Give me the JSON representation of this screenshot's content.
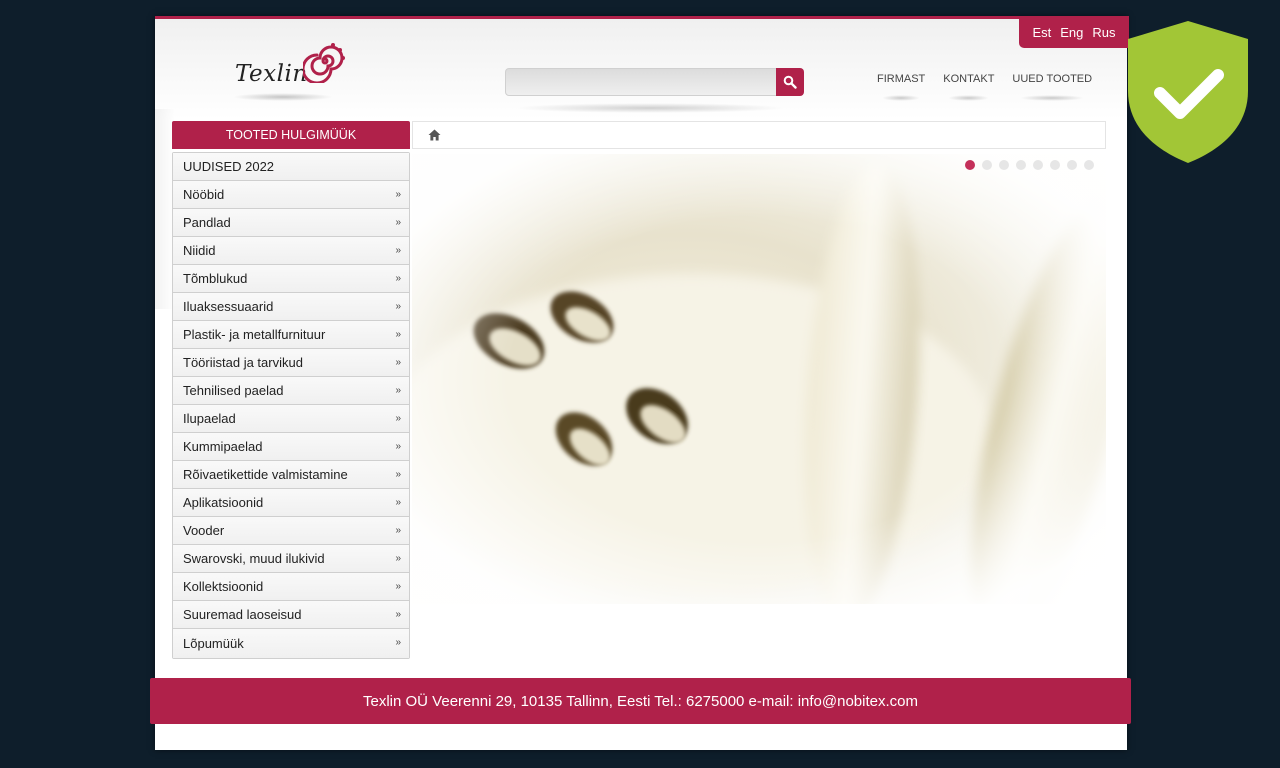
{
  "brand": {
    "logo_text": "Texlin",
    "accent": "#b0214a"
  },
  "lang": [
    "Est",
    "Eng",
    "Rus"
  ],
  "search": {
    "placeholder": ""
  },
  "topnav": [
    "FIRMAST",
    "KONTAKT",
    "UUED TOOTED"
  ],
  "sidebar": {
    "title": "TOOTED HULGIMÜÜK",
    "items": [
      {
        "label": "UUDISED 2022",
        "has_arrow": false
      },
      {
        "label": "Nööbid",
        "has_arrow": true
      },
      {
        "label": "Pandlad",
        "has_arrow": true
      },
      {
        "label": "Niidid",
        "has_arrow": true
      },
      {
        "label": "Tõmblukud",
        "has_arrow": true
      },
      {
        "label": "Iluaksessuaarid",
        "has_arrow": true
      },
      {
        "label": "Plastik- ja metallfurnituur",
        "has_arrow": true
      },
      {
        "label": "Tööriistad ja tarvikud",
        "has_arrow": true
      },
      {
        "label": "Tehnilised paelad",
        "has_arrow": true
      },
      {
        "label": "Ilupaelad",
        "has_arrow": true
      },
      {
        "label": "Kummipaelad",
        "has_arrow": true
      },
      {
        "label": "Rõivaetikettide valmistamine",
        "has_arrow": true
      },
      {
        "label": "Aplikatsioonid",
        "has_arrow": true
      },
      {
        "label": "Vooder",
        "has_arrow": true
      },
      {
        "label": "Swarovski, muud ilukivid",
        "has_arrow": true
      },
      {
        "label": "Kollektsioonid",
        "has_arrow": true
      },
      {
        "label": "Suuremad laoseisud",
        "has_arrow": true
      },
      {
        "label": "Lõpumüük",
        "has_arrow": true
      }
    ]
  },
  "breadcrumb": {
    "icon": "home-icon"
  },
  "slider": {
    "total_slides": 8,
    "active_slide": 1
  },
  "footer": {
    "text": "Texlin OÜ Veerenni 29, 10135 Tallinn, Eesti Tel.: 6275000 e-mail: info@nobitex.com"
  },
  "badge": {
    "icon": "shield-check-icon",
    "color": "#a2c636"
  }
}
